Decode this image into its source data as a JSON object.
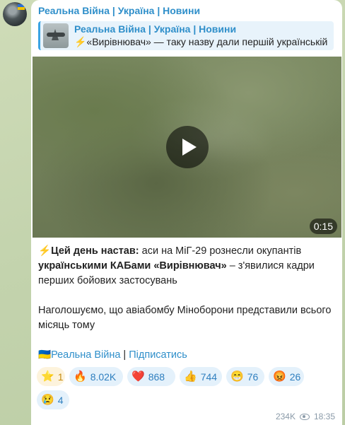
{
  "channel": {
    "name": "Реальна Війна | Україна | Новини"
  },
  "reply": {
    "title": "Реальна Війна | Україна | Новини",
    "text": "⚡️«Вирівнювач» — таку назву дали першій українській"
  },
  "video": {
    "duration": "0:15"
  },
  "message": {
    "bolt": "⚡",
    "lead_bold": "Цей день настав:",
    "lead_rest": " аси на МіГ-29 рознесли окупантів ",
    "bold2": "українськими КАБами «Вирівнювач»",
    "rest2": " – з'явилися кадри перших бойових застосувань",
    "paragraph2": "Наголошуємо, що авіабомбу Міноборони представили всього місяць тому",
    "footer_flag": "🇺🇦",
    "footer_link1": "Реальна Війна",
    "footer_sep": " | ",
    "footer_link2": "Підписатись"
  },
  "reactions": [
    {
      "emoji": "⭐",
      "count": "1",
      "icon": "star-icon"
    },
    {
      "emoji": "🔥",
      "count": "8.02K",
      "icon": "fire-icon"
    },
    {
      "emoji": "❤️",
      "count": "868",
      "icon": "heart-icon"
    },
    {
      "emoji": "👍",
      "count": "744",
      "icon": "thumbs-up-icon"
    },
    {
      "emoji": "😁",
      "count": "76",
      "icon": "grin-icon"
    },
    {
      "emoji": "😡",
      "count": "26",
      "icon": "angry-icon"
    },
    {
      "emoji": "😢",
      "count": "4",
      "icon": "crying-icon"
    }
  ],
  "meta": {
    "views": "234K",
    "time": "18:35"
  },
  "colors": {
    "accent": "#2f8fca",
    "reaction_bg": "#e4f1fb",
    "background": "#c9d9b4"
  }
}
